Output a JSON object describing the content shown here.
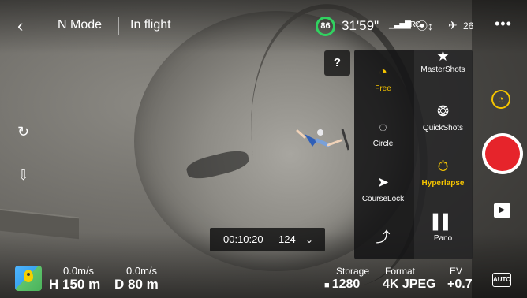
{
  "header": {
    "back_icon": "chevron-left-icon",
    "flight_mode": "N Mode",
    "status": "In flight",
    "battery_percent": "86",
    "flight_time": "31'59\"",
    "signal_label": "RC",
    "gps_icon": "gps-icon",
    "satellite_count": "26",
    "more_icon": "more-icon"
  },
  "side": {
    "left_icons": [
      "route-icon",
      "landing-icon"
    ]
  },
  "help_label": "?",
  "mode_panel": {
    "left_column": [
      {
        "label": "Free",
        "icon": "free-icon",
        "active": true
      },
      {
        "label": "Circle",
        "icon": "circle-icon",
        "active": false
      },
      {
        "label": "CourseLock",
        "icon": "courselock-icon",
        "active": false
      },
      {
        "label": "",
        "icon": "waypoint-icon",
        "active": false
      }
    ],
    "right_column": [
      {
        "label": "MasterShots",
        "icon": "mastershots-icon",
        "active": false
      },
      {
        "label": "QuickShots",
        "icon": "quickshots-icon",
        "active": false
      },
      {
        "label": "Hyperlapse",
        "icon": "hyperlapse-icon",
        "active": true
      },
      {
        "label": "Pano",
        "icon": "pano-icon",
        "active": false
      }
    ]
  },
  "timeline": {
    "time": "00:10:20",
    "count": "124",
    "chevron_icon": "chevron-down-icon"
  },
  "telemetry": {
    "h_speed": "0.0m/s",
    "v_speed": "0.0m/s",
    "height": "H 150 m",
    "distance": "D 80 m"
  },
  "camera": {
    "storage_label": "Storage",
    "storage_value": "1280",
    "format_label": "Format",
    "format_value": "4K JPEG",
    "ev_label": "EV",
    "ev_value": "+0.7"
  },
  "controls": {
    "auto_label": "AUTO",
    "accent_color": "#f5c400",
    "shutter_color": "#e6242b",
    "battery_color": "#31d160"
  }
}
